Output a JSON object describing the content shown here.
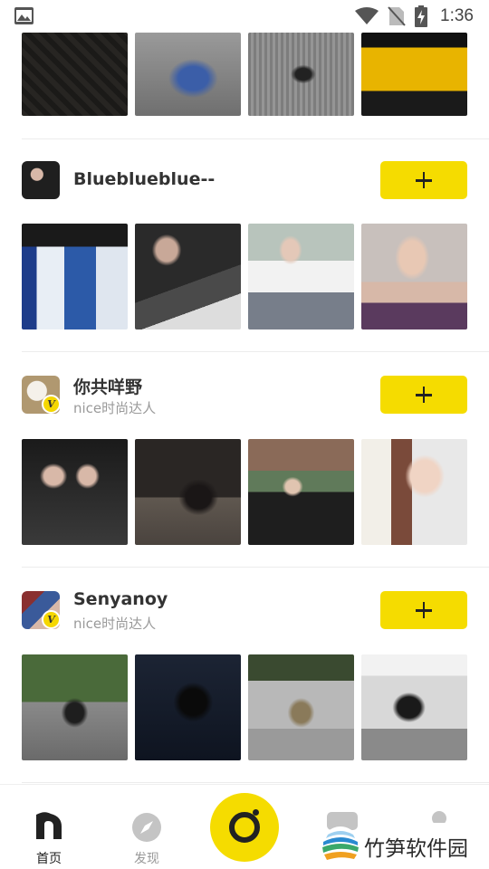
{
  "status_bar": {
    "time": "1:36"
  },
  "feed": {
    "users": [
      {
        "name": "Blueblueblue--",
        "subtitle": ""
      },
      {
        "name": "你共咩野",
        "subtitle": "nice时尚达人"
      },
      {
        "name": "Senyanoy",
        "subtitle": "nice时尚达人"
      }
    ]
  },
  "tab_bar": {
    "home_label": "首页",
    "discover_label": "发现"
  },
  "watermark": {
    "text": "竹笋软件园"
  }
}
